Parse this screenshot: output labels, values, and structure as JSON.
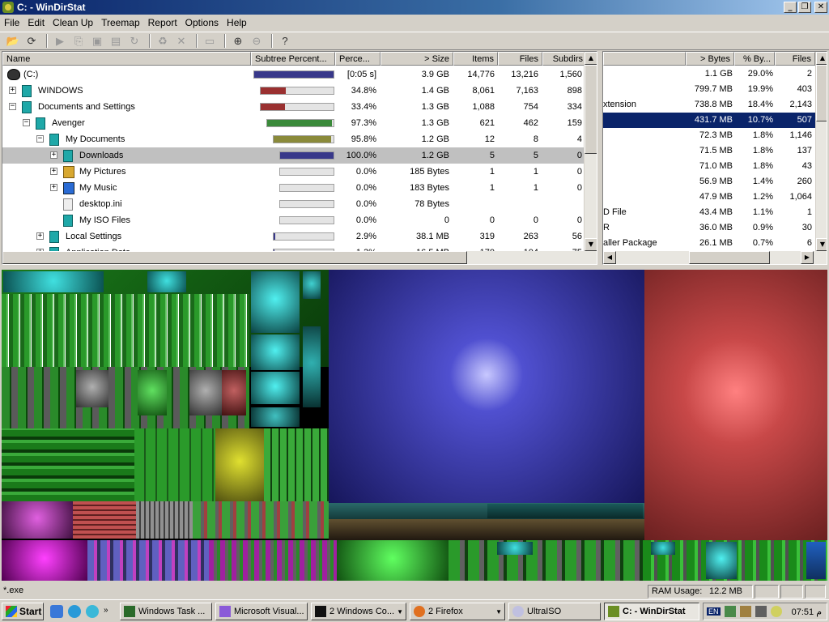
{
  "window": {
    "title": "C: - WinDirStat"
  },
  "window_buttons": {
    "minimize": "_",
    "maximize": "❐",
    "close": "✕"
  },
  "menu": [
    "File",
    "Edit",
    "Clean Up",
    "Treemap",
    "Report",
    "Options",
    "Help"
  ],
  "toolbar_icons": [
    "open-folder-icon",
    "refresh-icon",
    "play-icon",
    "copy-icon",
    "explorer-icon",
    "command-prompt-icon",
    "refresh-selected-icon",
    "recycle-icon",
    "delete-icon",
    "new-folder-icon",
    "zoom-in-icon",
    "zoom-out-icon",
    "help-icon"
  ],
  "tree": {
    "columns": [
      "Name",
      "Subtree Percent...",
      "Perce...",
      "> Size",
      "Items",
      "Files",
      "Subdirs"
    ],
    "rows": [
      {
        "name": "(C:)",
        "icon": "drive",
        "level": 0,
        "expander": "",
        "bar": 1.0,
        "bar_color": "#38388a",
        "percent": "[0:05 s]",
        "size": "3.9 GB",
        "items": "14,776",
        "files": "13,216",
        "subdirs": "1,560"
      },
      {
        "name": "WINDOWS",
        "icon": "folder",
        "level": 1,
        "expander": "+",
        "bar": 0.348,
        "bar_color": "#9a3030",
        "percent": "34.8%",
        "size": "1.4 GB",
        "items": "8,061",
        "files": "7,163",
        "subdirs": "898"
      },
      {
        "name": "Documents and Settings",
        "icon": "folder",
        "level": 1,
        "expander": "−",
        "bar": 0.334,
        "bar_color": "#9a3030",
        "percent": "33.4%",
        "size": "1.3 GB",
        "items": "1,088",
        "files": "754",
        "subdirs": "334"
      },
      {
        "name": "Avenger",
        "icon": "folder",
        "level": 2,
        "expander": "−",
        "bar": 0.973,
        "bar_color": "#3a8a3a",
        "percent": "97.3%",
        "size": "1.3 GB",
        "items": "621",
        "files": "462",
        "subdirs": "159"
      },
      {
        "name": "My Documents",
        "icon": "folder",
        "level": 3,
        "expander": "−",
        "bar": 0.958,
        "bar_color": "#8a8a3a",
        "percent": "95.8%",
        "size": "1.2 GB",
        "items": "12",
        "files": "8",
        "subdirs": "4"
      },
      {
        "name": "Downloads",
        "icon": "folder",
        "level": 4,
        "expander": "+",
        "bar": 1.0,
        "bar_color": "#38388a",
        "percent": "100.0%",
        "size": "1.2 GB",
        "items": "5",
        "files": "5",
        "subdirs": "0",
        "selected": true
      },
      {
        "name": "My Pictures",
        "icon": "pictures",
        "level": 4,
        "expander": "+",
        "bar": 0.0,
        "bar_color": "#38388a",
        "percent": "0.0%",
        "size": "185 Bytes",
        "items": "1",
        "files": "1",
        "subdirs": "0"
      },
      {
        "name": "My Music",
        "icon": "music",
        "level": 4,
        "expander": "+",
        "bar": 0.0,
        "bar_color": "#38388a",
        "percent": "0.0%",
        "size": "183 Bytes",
        "items": "1",
        "files": "1",
        "subdirs": "0"
      },
      {
        "name": "desktop.ini",
        "icon": "file",
        "level": 4,
        "expander": "",
        "bar": 0.0,
        "bar_color": "#38388a",
        "percent": "0.0%",
        "size": "78 Bytes",
        "items": "",
        "files": "",
        "subdirs": ""
      },
      {
        "name": "My ISO Files",
        "icon": "folder",
        "level": 4,
        "expander": "",
        "bar": 0.0,
        "bar_color": "#38388a",
        "percent": "0.0%",
        "size": "0",
        "items": "0",
        "files": "0",
        "subdirs": "0"
      },
      {
        "name": "Local Settings",
        "icon": "folder",
        "level": 3,
        "expander": "+",
        "bar": 0.029,
        "bar_color": "#38388a",
        "percent": "2.9%",
        "size": "38.1 MB",
        "items": "319",
        "files": "263",
        "subdirs": "56"
      },
      {
        "name": "Application Data",
        "icon": "folder",
        "level": 3,
        "expander": "+",
        "bar": 0.013,
        "bar_color": "#38388a",
        "percent": "1.3%",
        "size": "16.5 MB",
        "items": "170",
        "files": "104",
        "subdirs": "75"
      }
    ]
  },
  "extensions": {
    "columns": [
      "> Bytes",
      "% By...",
      "Files"
    ],
    "rows": [
      {
        "desc": "",
        "bytes": "1.1 GB",
        "percent": "29.0%",
        "files": "2"
      },
      {
        "desc": "",
        "bytes": "799.7 MB",
        "percent": "19.9%",
        "files": "403"
      },
      {
        "desc": "xtension",
        "bytes": "738.8 MB",
        "percent": "18.4%",
        "files": "2,143"
      },
      {
        "desc": "",
        "bytes": "431.7 MB",
        "percent": "10.7%",
        "files": "507",
        "selected": true
      },
      {
        "desc": "",
        "bytes": "72.3 MB",
        "percent": "1.8%",
        "files": "1,146"
      },
      {
        "desc": "",
        "bytes": "71.5 MB",
        "percent": "1.8%",
        "files": "137"
      },
      {
        "desc": "",
        "bytes": "71.0 MB",
        "percent": "1.8%",
        "files": "43"
      },
      {
        "desc": "",
        "bytes": "56.9 MB",
        "percent": "1.4%",
        "files": "260"
      },
      {
        "desc": "",
        "bytes": "47.9 MB",
        "percent": "1.2%",
        "files": "1,064"
      },
      {
        "desc": "D File",
        "bytes": "43.4 MB",
        "percent": "1.1%",
        "files": "1"
      },
      {
        "desc": "R",
        "bytes": "36.0 MB",
        "percent": "0.9%",
        "files": "30"
      },
      {
        "desc": "aller Package",
        "bytes": "26.1 MB",
        "percent": "0.7%",
        "files": "6"
      }
    ]
  },
  "status": {
    "path": "*.exe",
    "ram_label": "RAM Usage:",
    "ram_value": "12.2 MB"
  },
  "taskbar": {
    "start": "Start",
    "tasks": [
      "Windows Task ...",
      "Microsoft Visual...",
      "2 Windows Co...",
      "2 Firefox",
      "UltraISO",
      "C: - WinDirStat"
    ],
    "clock": "07:51 م",
    "language": "EN"
  },
  "colors": {
    "title_start": "#0a246a",
    "title_end": "#a6caf0",
    "selection": "#0a246a",
    "treemap_blue": "#3a3aa8",
    "treemap_red": "#c04040"
  }
}
